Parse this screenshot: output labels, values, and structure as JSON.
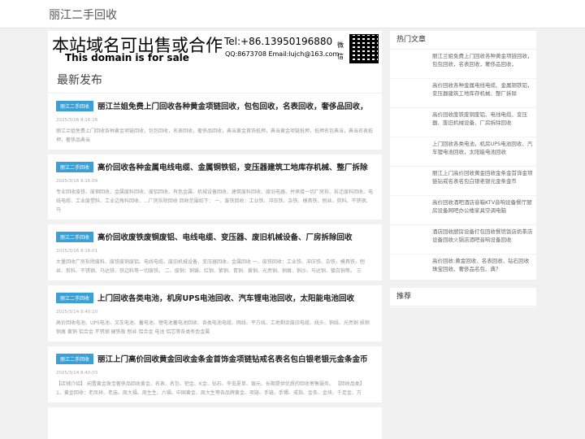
{
  "site_title": "丽江二手回收",
  "banner": {
    "cn": "本站域名可出售或合作",
    "en": "This domain is for sale",
    "tel": "Tel:+86.13950196880",
    "qq": "QQ:8673708 Email:lujch@163.com",
    "wx1": "微",
    "wx2": "信"
  },
  "section_title": "最新发布",
  "posts": [
    {
      "tag": "丽江二手回收",
      "title": "丽江兰姐免费上门回收各种黄金项链回收，包包回收，名表回收，奢侈品回收，",
      "meta": "2025/3/16 8:16:16",
      "desc": "丽江兰姐免费上门回收各种黄金项链回收，包包回收，名表回收，奢侈品回收，典当黄金首饰抵押，典当黄金项链抵押，抵押名包典当，典当名表抵押，奢侈品典当"
    },
    {
      "tag": "丽江二手回收",
      "title": "高价回收各种金属电线电缆、金属铜铁铝，变压器建筑工地库存机械、整厂拆除",
      "meta": "2025/3/16 8:16:09",
      "desc": "专业回收废铁、废钢回收、金属废料回收、废铝回收、有色金属、机械设备回收、建筑废料回收、废旧电器、并承接一切厂房拆、拆迁废料回收、电线电缆、工业废塑料、工业边角料回收、...厂房拆除回收 回收范围如下： 一、废铁回收：工业铁、冲压铁、杂铁、模具铁、刨丝、剪料、不锈钢、马"
    },
    {
      "tag": "丽江二手回收",
      "title": "高价回收废铁废铜废铝、电线电缆、变压器、废旧机械设备、厂房拆除回收",
      "meta": "2025/3/16 8:16:01",
      "desc": "大量回收厂房拆除废料、废铁废铜废铝、电线电缆、废旧机械设备、变压器回收、金属回收 一、废铁回收：工业铁、冲压铁、杂铁、模具铁、刨丝、剪料、不锈钢、马达铁、铁边料等一切废铁。 二、废铜：铜铸、红铜、紫铜、青铜、黄铜、光亮铜、铜屑、铜沙、马达铜、镀白铜等。 三"
    },
    {
      "tag": "丽江二手回收",
      "title": "上门回收各类电池，机房UPS电池回收、汽车锂电池回收，太阳能电池回收",
      "meta": "2025/3/14 8:40:10",
      "desc": "高价回收电池、UPS电池、叉车电池、蓄电池、锂电池蓄电池回收、各类电池电缆、网线、平方线、工地剩余废旧电缆、线头、铜线、光亮铜 损铜 铜屑 黄铜 铝合金 不锈钢 硬铁板 刨丝 铝合金 电池 铝芯等各类有色金属"
    },
    {
      "tag": "丽江二手回收",
      "title": "丽江上门高价回收黄金回收金条金首饰金项链钻戒名表名包白银老银元金条金币",
      "meta": "2025/3/14 8:40:03",
      "desc": "【店铺介绍】 闲置黄金珠宝奢侈品回收黄金、名表、名包、钯金、K金、钻石、冬虫夏草、银元、长期提供优质的回收寄售服务。 【回收品类】 1、黄金回收：老凤祥、老庙、周大福、周生生、六福、中国黄金、周大生等各品牌黄金、项链、手链、手镯、戒指、金条、金块、千足金、万"
    }
  ],
  "sidebar": {
    "hot_title": "热门文章",
    "hot_items": [
      "丽江兰姐免费上门回收各种黄金项链回收，包包回收，名表回收，奢侈品回收，",
      "高价回收各种金属电线电缆、金属铜铁铝，变压器建筑工地库存机械、整厂拆除",
      "高价回收废铁废铜废铝、电线电缆、变压器、废旧机械设备、厂房拆除回收",
      "上门回收各类电池，机房UPS电池回收、汽车锂电池回收，太阳能电池回收",
      "丽江上门高价回收黄金回收金条金首饰金项链钻戒名表名包白银老银元金条金币",
      "高价回收酒吧酒店音箱KTV音响设备餐厅厨房设备网吧办公楼家具空调电脑",
      "酒店回收厨房设备打包回收餐馆饭店奶茶店设备回收火锅店酒吧音响设备回收",
      "高价回收:黄金回收、名表回收、钻石回收珠宝回收、奢侈品名包、典？"
    ],
    "rec_title": "推荐"
  }
}
